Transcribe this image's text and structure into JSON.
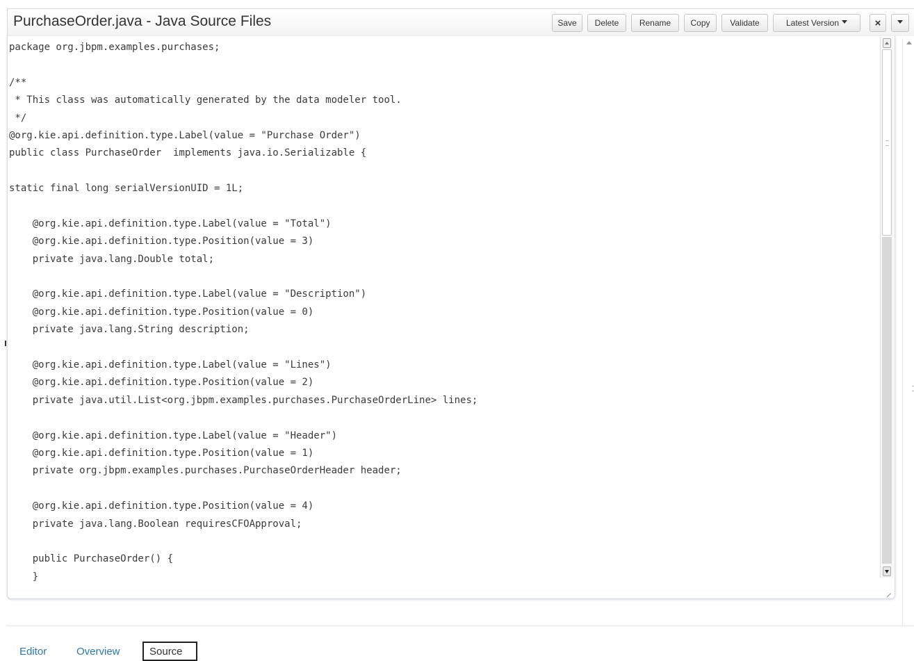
{
  "window": {
    "title": "PurchaseOrder.java - Java Source Files"
  },
  "toolbar": {
    "save_label": "Save",
    "delete_label": "Delete",
    "rename_label": "Rename",
    "copy_label": "Copy",
    "validate_label": "Validate",
    "version_label": "Latest Version",
    "close_label": "×"
  },
  "icons": {
    "close": "close-icon",
    "version_caret": "caret-down-icon",
    "menu_caret": "caret-down-icon",
    "scroll_up": "scroll-up-icon",
    "scroll_down": "scroll-down-icon",
    "resize": "resize-grip-icon"
  },
  "source": {
    "lines": [
      "package org.jbpm.examples.purchases;",
      "",
      "/**",
      " * This class was automatically generated by the data modeler tool.",
      " */",
      "@org.kie.api.definition.type.Label(value = \"Purchase Order\")",
      "public class PurchaseOrder  implements java.io.Serializable {",
      "",
      "static final long serialVersionUID = 1L;",
      "",
      "    @org.kie.api.definition.type.Label(value = \"Total\")",
      "    @org.kie.api.definition.type.Position(value = 3)",
      "    private java.lang.Double total;",
      "",
      "    @org.kie.api.definition.type.Label(value = \"Description\")",
      "    @org.kie.api.definition.type.Position(value = 0)",
      "    private java.lang.String description;",
      "",
      "    @org.kie.api.definition.type.Label(value = \"Lines\")",
      "    @org.kie.api.definition.type.Position(value = 2)",
      "    private java.util.List<org.jbpm.examples.purchases.PurchaseOrderLine> lines;",
      "",
      "    @org.kie.api.definition.type.Label(value = \"Header\")",
      "    @org.kie.api.definition.type.Position(value = 1)",
      "    private org.jbpm.examples.purchases.PurchaseOrderHeader header;",
      "",
      "    @org.kie.api.definition.type.Position(value = 4)",
      "    private java.lang.Boolean requiresCFOApproval;",
      "",
      "    public PurchaseOrder() {",
      "    }"
    ]
  },
  "tabs": {
    "editor": "Editor",
    "overview": "Overview",
    "source": "Source",
    "active": "Source"
  },
  "colors": {
    "link": "#2a7ab0",
    "text": "#333333",
    "code": "#3a3a3a"
  }
}
